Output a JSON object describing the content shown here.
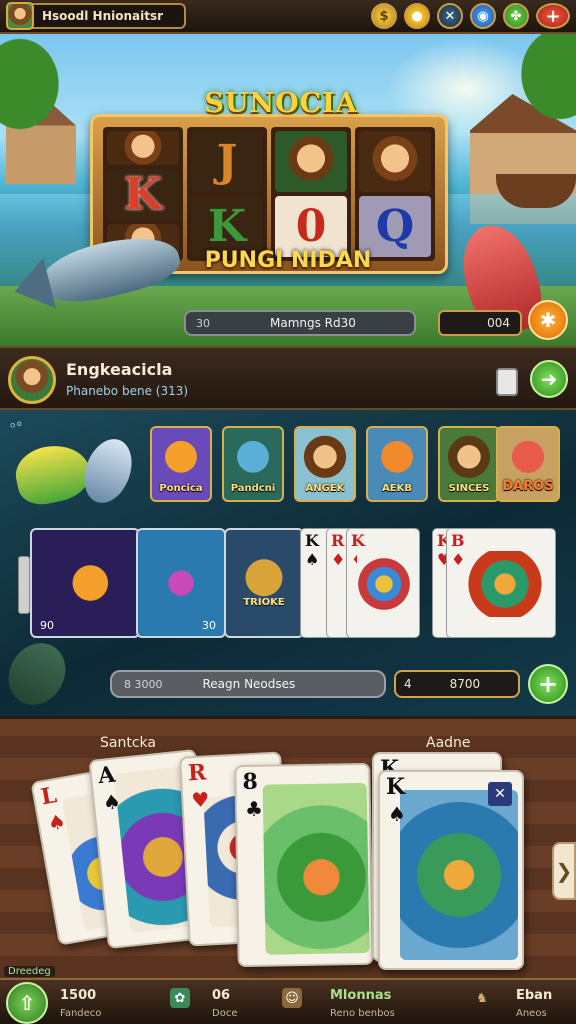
{
  "topbar": {
    "profile_name": "Hsoodl Hnionaitsr",
    "icons": [
      "coin-icon",
      "gold-coin-icon",
      "crossed-tools-icon",
      "blue-gem-icon",
      "clover-icon",
      "close-icon"
    ],
    "icon_glyphs": [
      "$",
      "●",
      "✕",
      "◉",
      "✤",
      "+"
    ]
  },
  "hero": {
    "logo": "SUNOCIA",
    "symbols": [
      "K",
      "J",
      "K",
      "0",
      "Q"
    ],
    "title": "PUNGI NIDAN",
    "bar_tag": "30",
    "bar_label": "Mamngs Rd30",
    "balance": "004",
    "star_glyph": "✱"
  },
  "user": {
    "name": "Engkeacicla",
    "subtitle": "Phanebo bene (313)",
    "go_glyph": "➜"
  },
  "games": {
    "bubbles": "ᵒ°",
    "tiles": [
      "Poncica",
      "Pandcni",
      "ANGEK",
      "AEKB",
      "SINCES",
      "DAROS"
    ],
    "featured": [
      {
        "caption": "",
        "num": "90"
      },
      {
        "caption": "",
        "num": "30"
      },
      {
        "caption": "TRIOKE",
        "num": ""
      }
    ],
    "cards": [
      {
        "rank": "K",
        "suit": "♠",
        "red": false
      },
      {
        "rank": "R",
        "suit": "♦",
        "red": true
      },
      {
        "rank": "K",
        "suit": "♦",
        "red": true
      },
      {
        "rank": "K",
        "suit": "♥",
        "red": true
      },
      {
        "rank": "B",
        "suit": "♦",
        "red": true
      }
    ],
    "search_tag": "8 3000",
    "search_label": "Reagn Neodses",
    "balance_prefix": "4",
    "balance_value": "8700",
    "plus_glyph": "+"
  },
  "table": {
    "left_label": "Santcka",
    "right_label": "Aadne",
    "cards": [
      {
        "rank": "L",
        "suit": "♠",
        "red": true
      },
      {
        "rank": "A",
        "suit": "♠",
        "red": false
      },
      {
        "rank": "R",
        "suit": "♥",
        "red": true
      },
      {
        "rank": "8",
        "suit": "♣",
        "red": false
      },
      {
        "rank": "K",
        "suit": "",
        "red": false
      },
      {
        "rank": "K",
        "suit": "♠",
        "red": false
      }
    ],
    "corner_glyph": "✕",
    "next_glyph": "❯"
  },
  "bottombar": {
    "tag": "Dreedeg",
    "home_glyph": "⇧",
    "items": [
      {
        "value": "1500",
        "sub": "Fandeco"
      },
      {
        "value": "06",
        "sub": "Doce"
      },
      {
        "value": "Mlonnas",
        "sub": "Reno benbos"
      },
      {
        "value": "Eban",
        "sub": "Aneos"
      }
    ],
    "icon_glyphs": [
      "✿",
      "☺",
      "♞"
    ]
  }
}
